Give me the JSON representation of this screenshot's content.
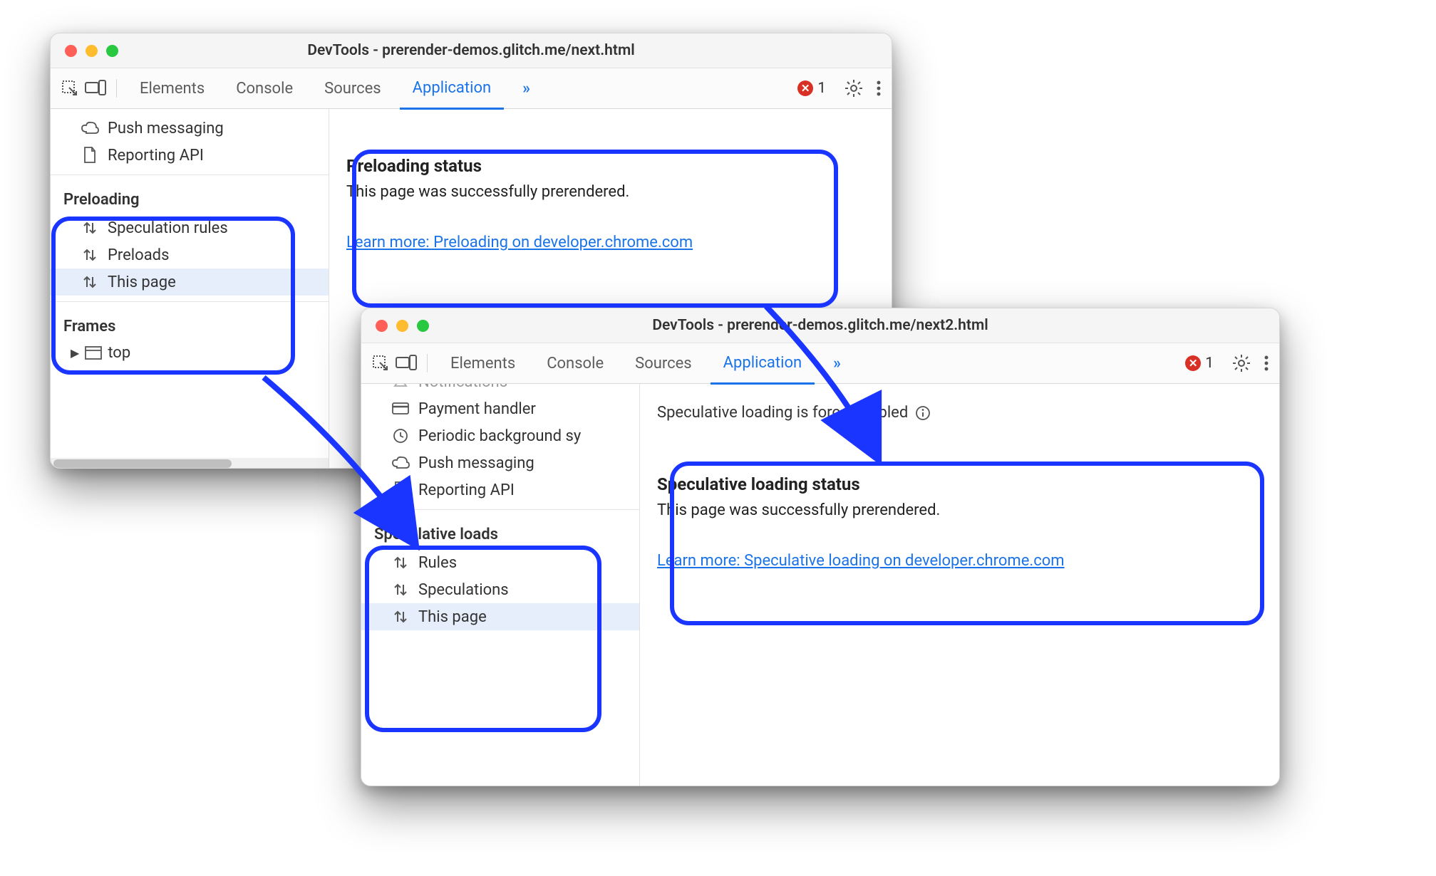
{
  "win1": {
    "title": "DevTools - prerender-demos.glitch.me/next.html",
    "tabs": {
      "elements": "Elements",
      "console": "Console",
      "sources": "Sources",
      "application": "Application",
      "more": "»"
    },
    "errors": "1",
    "sidebar": {
      "misc": {
        "push": "Push messaging",
        "report": "Reporting API"
      },
      "preloading_title": "Preloading",
      "preloading": {
        "rules": "Speculation rules",
        "preloads": "Preloads",
        "thispage": "This page"
      },
      "frames_title": "Frames",
      "frames_top": "top"
    },
    "panel": {
      "heading": "Preloading status",
      "text": "This page was successfully prerendered.",
      "link": "Learn more: Preloading on developer.chrome.com"
    }
  },
  "win2": {
    "title": "DevTools - prerender-demos.glitch.me/next2.html",
    "tabs": {
      "elements": "Elements",
      "console": "Console",
      "sources": "Sources",
      "application": "Application",
      "more": "»"
    },
    "errors": "1",
    "sidebar": {
      "misc": {
        "notif": "Notifications",
        "payment": "Payment handler",
        "periodic": "Periodic background sy",
        "push": "Push messaging",
        "report": "Reporting API"
      },
      "spec_title": "Speculative loads",
      "spec": {
        "rules": "Rules",
        "specs": "Speculations",
        "thispage": "This page"
      }
    },
    "force_text": "Speculative loading is force-enabled",
    "panel": {
      "heading": "Speculative loading status",
      "text": "This page was successfully prerendered.",
      "link": "Learn more: Speculative loading on developer.chrome.com"
    }
  }
}
